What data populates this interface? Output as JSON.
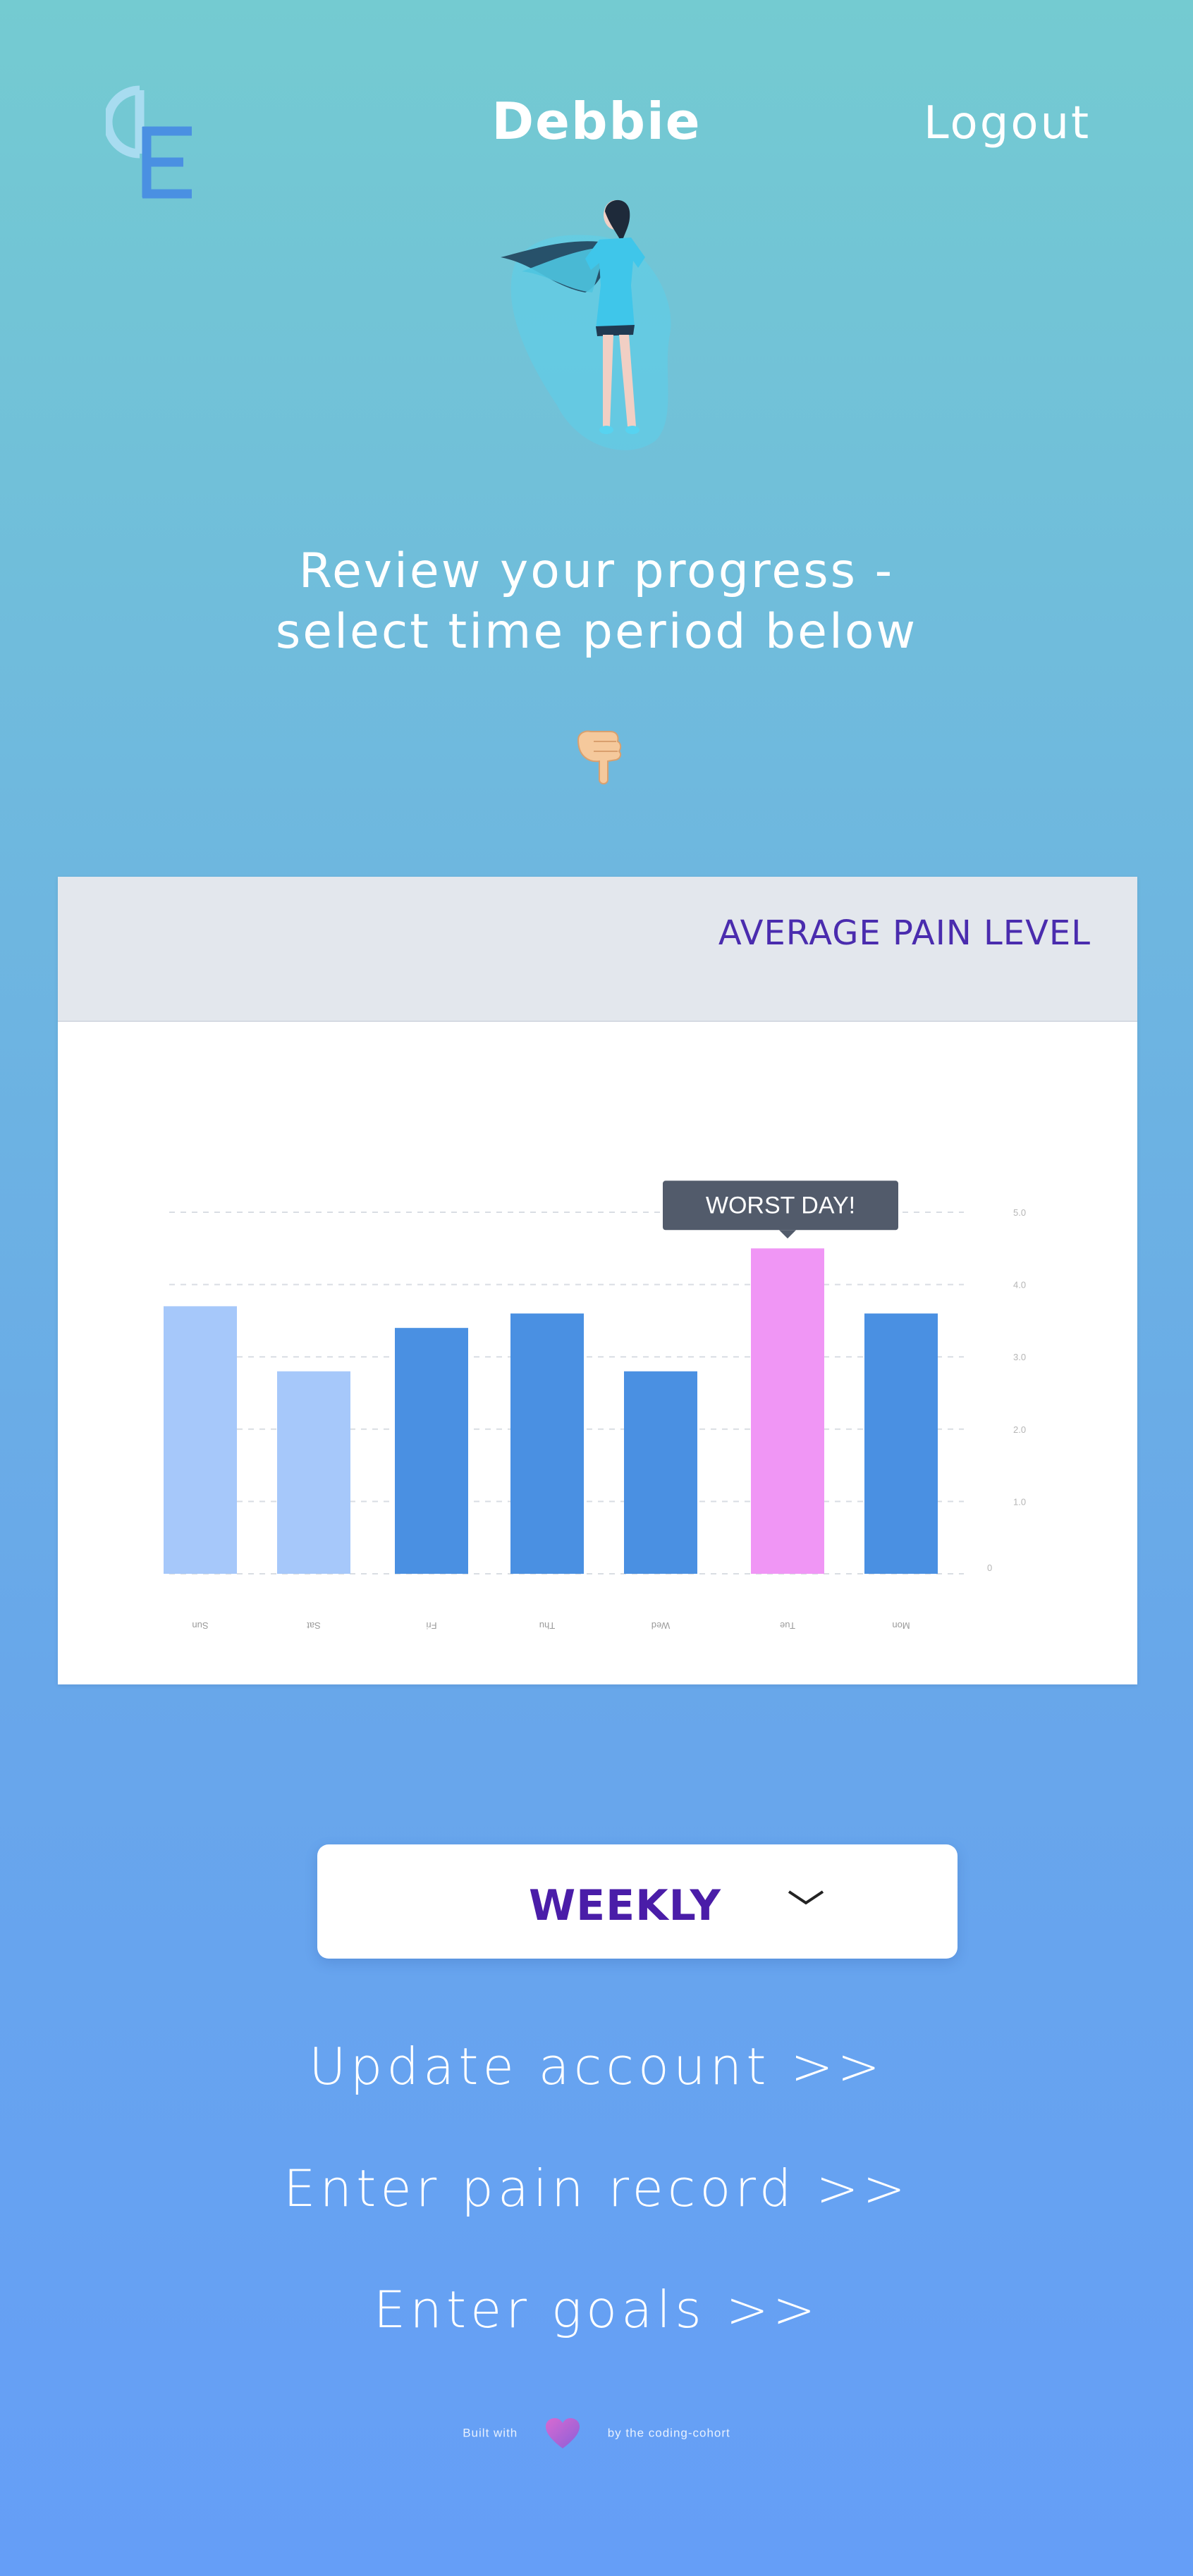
{
  "header": {
    "username": "Debbie",
    "logout_label": "Logout"
  },
  "headline": {
    "line1": "Review your progress -",
    "line2": "select time period below"
  },
  "chart_card": {
    "title": "AVERAGE PAIN LEVEL",
    "tooltip": "WORST DAY!"
  },
  "chart_data": {
    "type": "bar",
    "categories": [
      "Sun",
      "Sat",
      "Fri",
      "Thu",
      "Wed",
      "Tue",
      "Mon"
    ],
    "values": [
      3.7,
      2.8,
      3.4,
      3.6,
      2.8,
      4.5,
      3.6
    ],
    "highlight_index": 5,
    "y_ticks": [
      "0",
      "1.0",
      "2.0",
      "3.0",
      "4.0",
      "5.0"
    ],
    "ylim": [
      0,
      5
    ],
    "grid": true,
    "colors": {
      "faded": "#a6c8fa",
      "normal": "#4a90e2",
      "worst": "#f096f5"
    }
  },
  "dropdown": {
    "selected": "WEEKLY"
  },
  "links": [
    "Update account >>",
    "Enter pain record >>",
    "Enter goals >>"
  ],
  "footer": {
    "before": "Built with",
    "after": "by the coding-cohort"
  },
  "icons": {
    "logo": "logo-icon",
    "hero": "superhero-illustration",
    "pointer": "pointing-down-hand-icon",
    "chevron": "chevron-down-icon",
    "heart": "heart-icon"
  }
}
